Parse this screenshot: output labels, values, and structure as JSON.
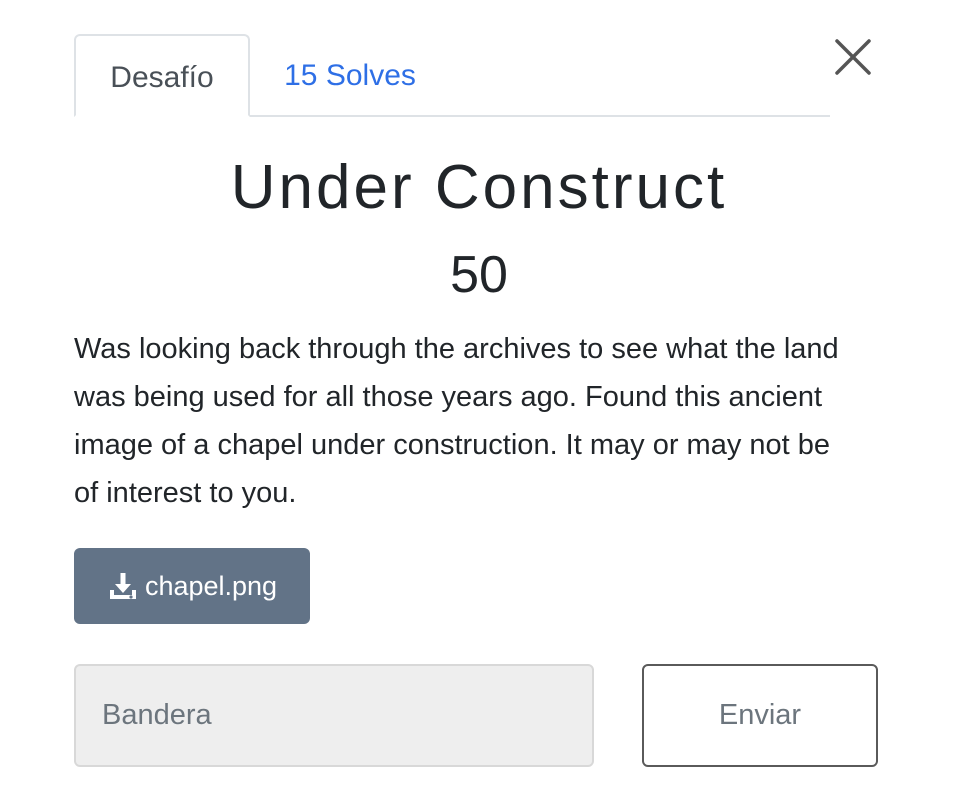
{
  "tabs": {
    "challenge_label": "Desafío",
    "solves_label": "15 Solves"
  },
  "challenge": {
    "name": "Under Construct",
    "points": "50",
    "description": "Was looking back through the archives to see what the land was being used for all those years ago. Found this ancient image of a chapel under construction. It may or may not be of interest to you."
  },
  "files": {
    "download_label": "chapel.png"
  },
  "form": {
    "flag_placeholder": "Bandera",
    "submit_label": "Enviar"
  },
  "icons": {
    "close": "close-icon",
    "download": "download-icon"
  },
  "colors": {
    "link": "#2e6fe6",
    "download_button": "#627387"
  }
}
